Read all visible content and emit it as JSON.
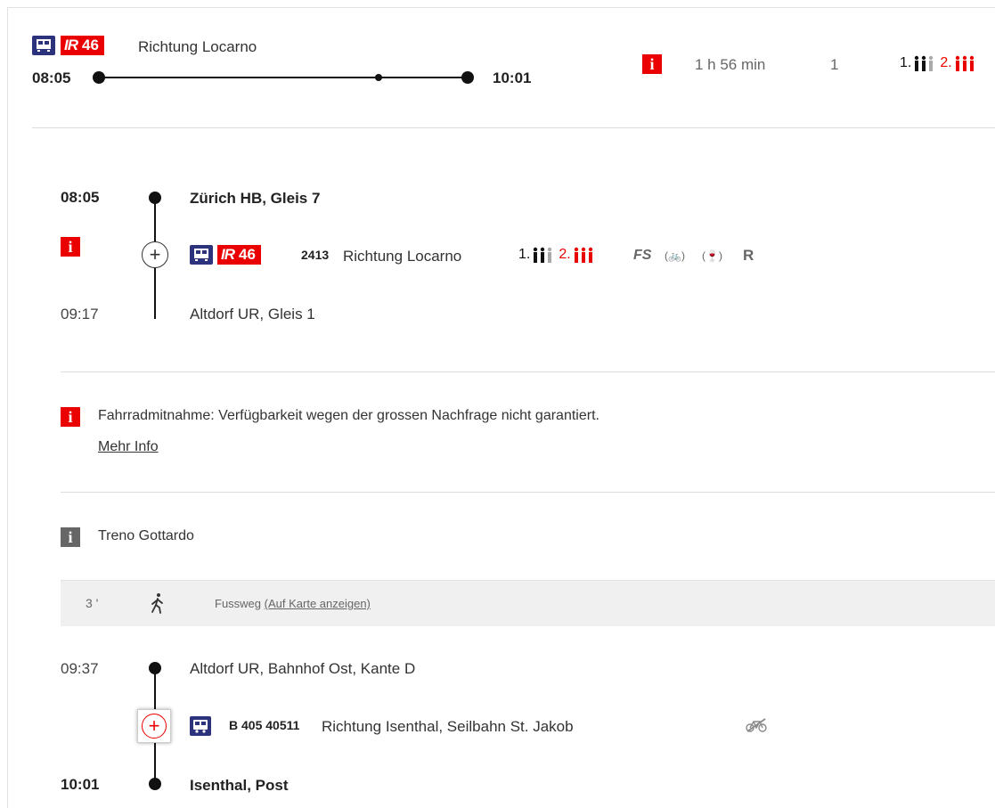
{
  "summary": {
    "line": "IR 46",
    "line_prefix": "IR",
    "line_number": "46",
    "direction": "Richtung Locarno",
    "departure": "08:05",
    "arrival": "10:01",
    "info_glyph": "i",
    "duration": "1 h 56 min",
    "transfers": "1",
    "class1_label": "1.",
    "class2_label": "2."
  },
  "sections": [
    {
      "dep_time": "08:05",
      "dep_stop": "Zürich HB, Gleis 7",
      "line_prefix": "IR",
      "line_number": "46",
      "train_number": "2413",
      "direction": "Richtung Locarno",
      "class1_label": "1.",
      "class2_label": "2.",
      "attr_fs": "FS",
      "attr_bike": "(🚲)",
      "attr_bistro": "(🍷)",
      "attr_r": "R",
      "arr_time": "09:17",
      "arr_stop": "Altdorf UR, Gleis 1"
    },
    {
      "dep_time": "09:37",
      "dep_stop": "Altdorf UR, Bahnhof Ost, Kante D",
      "line_label": "B 405 40511",
      "direction": "Richtung Isenthal, Seilbahn St. Jakob",
      "arr_time": "10:01",
      "arr_stop": "Isenthal, Post"
    }
  ],
  "notices": {
    "bike_notice": "Fahrradmitnahme: Verfügbarkeit wegen der grossen Nachfrage nicht garantiert.",
    "more_info": "Mehr Info",
    "treno": "Treno Gottardo"
  },
  "walk": {
    "minutes": "3 '",
    "label": "Fussweg",
    "map_link": "(Auf Karte anzeigen)"
  },
  "colors": {
    "sbb_red": "#eb0000",
    "sbb_blue": "#2d327d",
    "grey_band": "#f0f0f0"
  },
  "icons": [
    "train-icon",
    "info-icon",
    "person-occupancy-icon",
    "plus-icon",
    "walk-icon",
    "bus-icon",
    "bike-crossed-icon"
  ]
}
